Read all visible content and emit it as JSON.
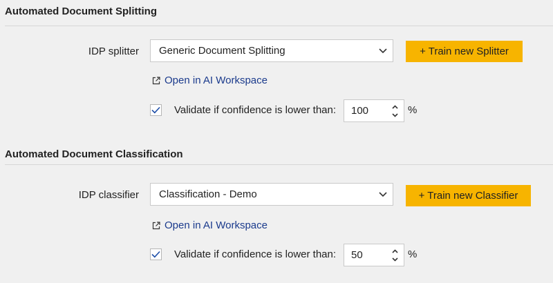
{
  "splitting": {
    "title": "Automated Document Splitting",
    "field_label": "IDP splitter",
    "selected": "Generic Document Splitting",
    "train_button": "+ Train new Splitter",
    "open_link": "Open in AI Workspace",
    "validate_checked": true,
    "validate_label": "Validate if confidence is lower than:",
    "threshold": "100",
    "unit": "%"
  },
  "classification": {
    "title": "Automated Document Classification",
    "field_label": "IDP classifier",
    "selected": "Classification - Demo",
    "train_button": "+ Train new Classifier",
    "open_link": "Open in AI Workspace",
    "validate_checked": true,
    "validate_label": "Validate if confidence is lower than:",
    "threshold": "50",
    "unit": "%"
  },
  "colors": {
    "accent_button": "#f7b400",
    "link": "#1a3a8c",
    "checkmark": "#1f4fa8"
  }
}
